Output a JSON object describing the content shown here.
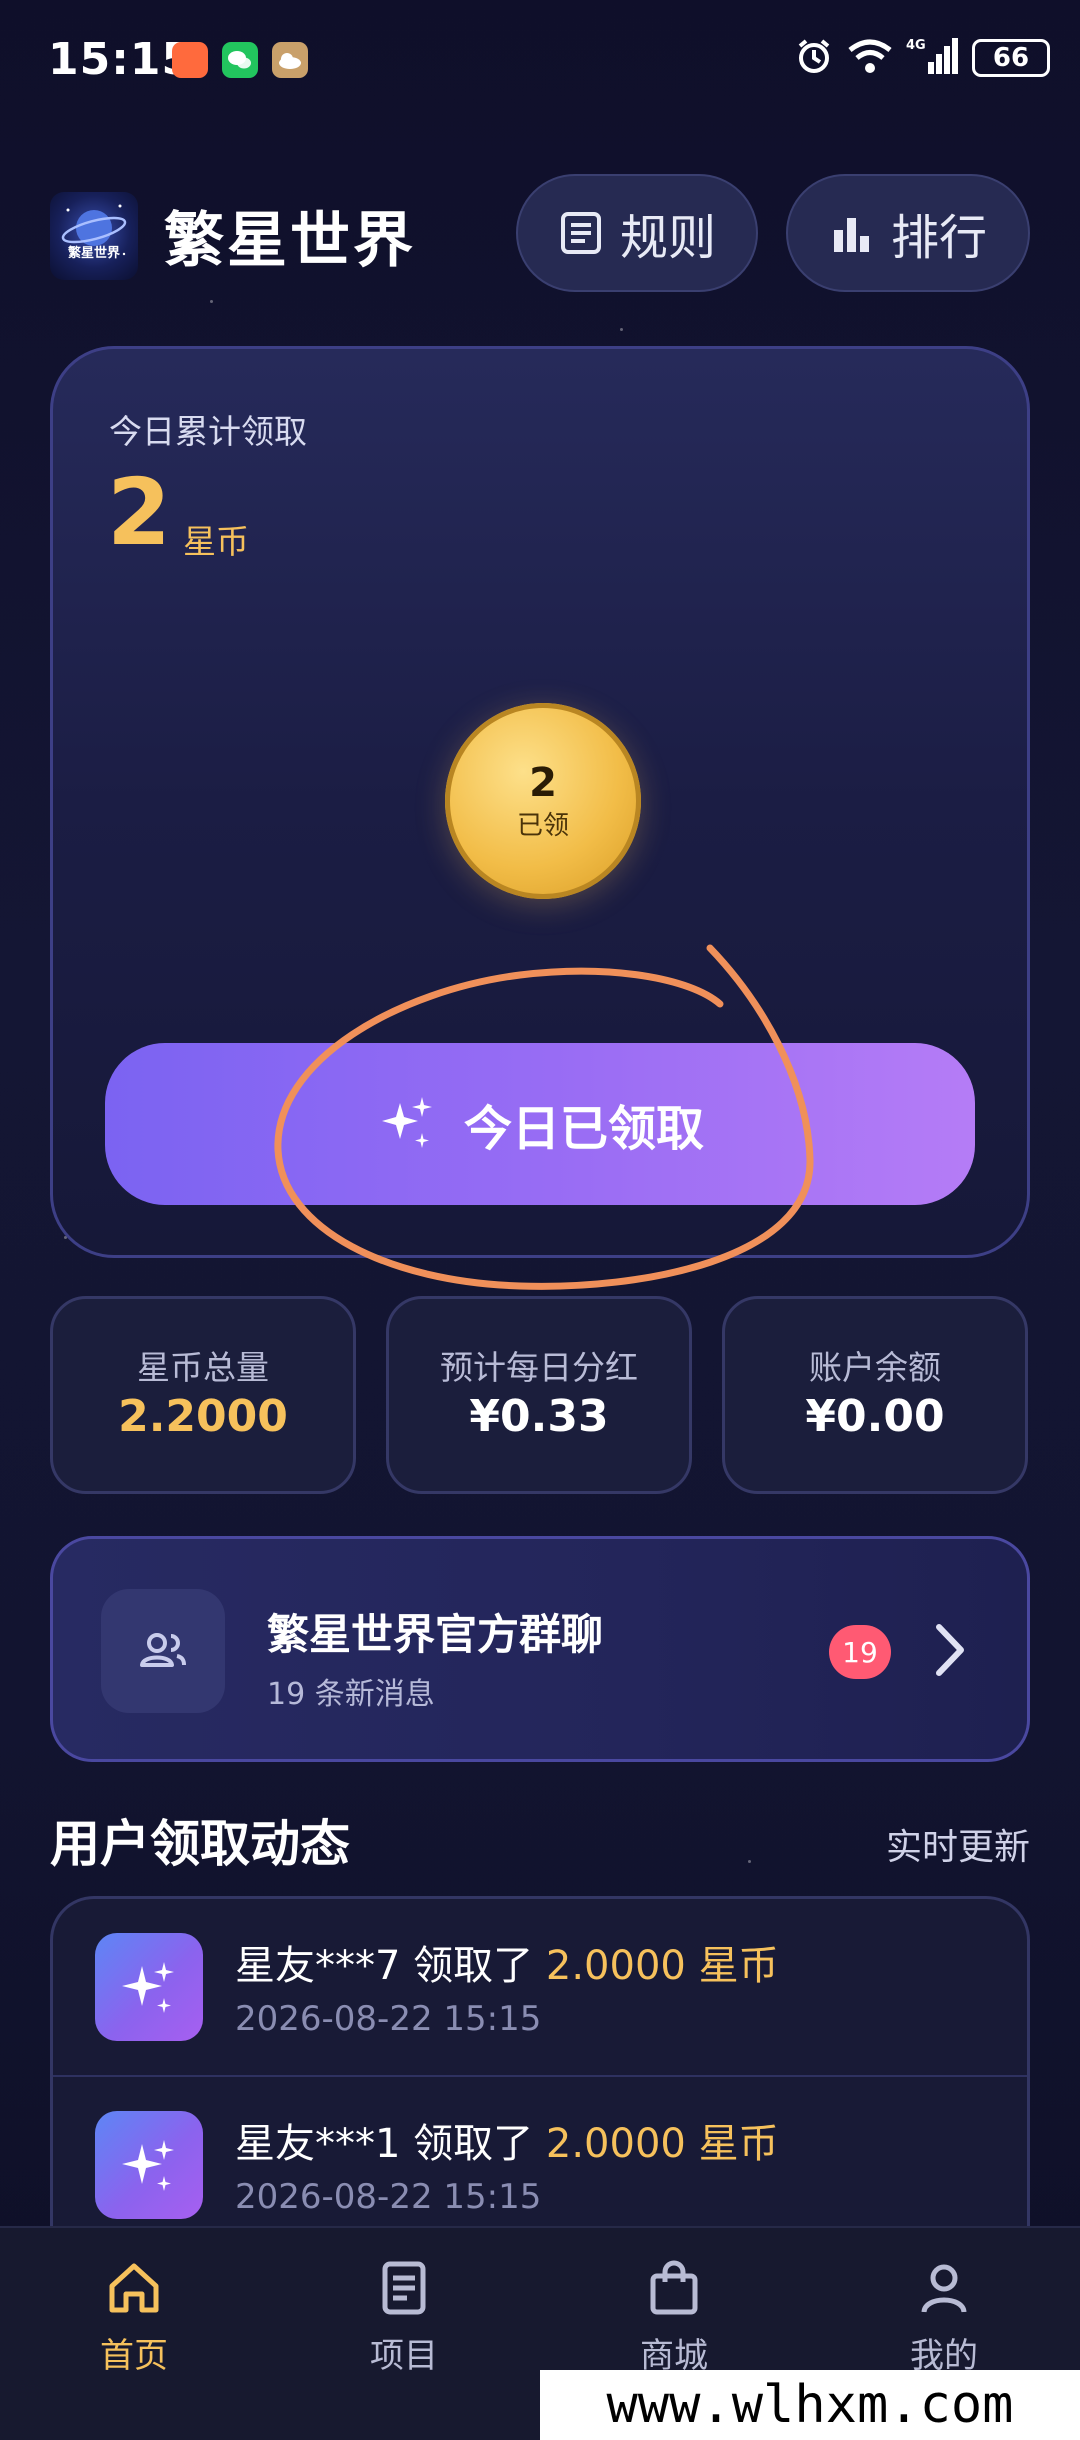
{
  "status_bar": {
    "time": "15:15",
    "battery": "66",
    "network": "4G"
  },
  "header": {
    "logo_text": "繁星世界",
    "app_title": "繁星世界",
    "rules_label": "规则",
    "rank_label": "排行"
  },
  "hero": {
    "label": "今日累计领取",
    "amount": "2",
    "unit": "星币",
    "coin_value": "2",
    "coin_status": "已领",
    "button_label": "今日已领取"
  },
  "stats": [
    {
      "label": "星币总量",
      "value": "2.2000",
      "color": "#f6c15c"
    },
    {
      "label": "预计每日分红",
      "value": "¥0.33",
      "color": "#ffffff"
    },
    {
      "label": "账户余额",
      "value": "¥0.00",
      "color": "#ffffff"
    }
  ],
  "group_chat": {
    "title": "繁星世界官方群聊",
    "subtitle": "19 条新消息",
    "badge": "19"
  },
  "feed": {
    "title": "用户领取动态",
    "live_label": "实时更新",
    "items": [
      {
        "user": "星友***7",
        "action": "领取了",
        "amount": "2.0000 星币",
        "time": "2026-08-22 15:15"
      },
      {
        "user": "星友***1",
        "action": "领取了",
        "amount": "2.0000 星币",
        "time": "2026-08-22 15:15"
      }
    ]
  },
  "bottom_nav": {
    "items": [
      {
        "label": "首页",
        "icon": "home-icon",
        "active": true
      },
      {
        "label": "项目",
        "icon": "document-icon",
        "active": false
      },
      {
        "label": "商城",
        "icon": "bag-icon",
        "active": false
      },
      {
        "label": "我的",
        "icon": "user-icon",
        "active": false
      }
    ]
  },
  "watermark": "www.wlhxm.com",
  "colors": {
    "accent_gold": "#f6c15c",
    "button_purple": "#8b68f4",
    "badge_red": "#ff5a73",
    "background": "#121430"
  }
}
